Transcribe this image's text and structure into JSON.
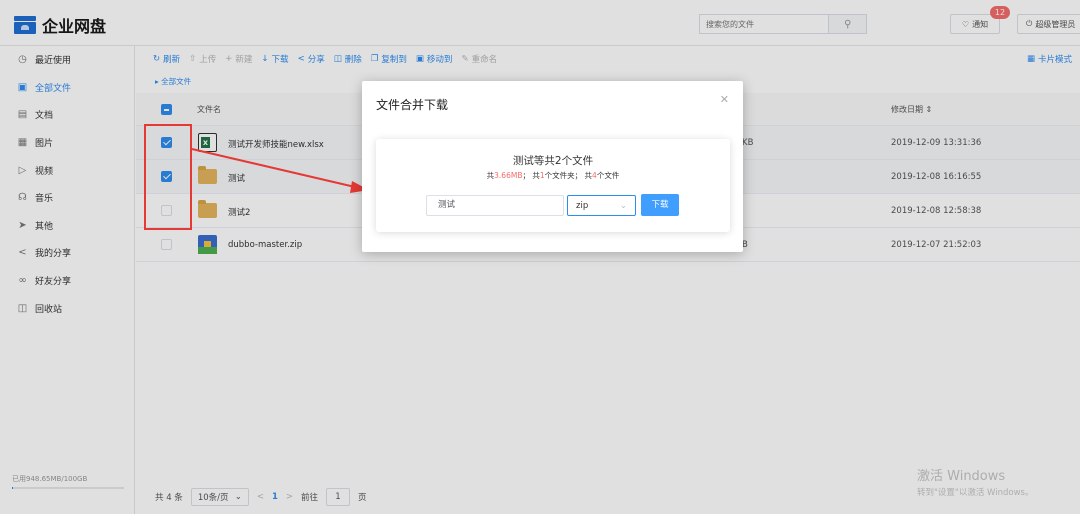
{
  "header": {
    "title": "企业网盘",
    "search_placeholder": "搜索您的文件",
    "notify_label": "通知",
    "notify_count": "12",
    "admin_label": "超级管理员"
  },
  "sidebar": {
    "items": [
      {
        "label": "最近使用",
        "icon": "clock-icon"
      },
      {
        "label": "全部文件",
        "icon": "folder-icon"
      },
      {
        "label": "文档",
        "icon": "document-icon"
      },
      {
        "label": "图片",
        "icon": "image-icon"
      },
      {
        "label": "视频",
        "icon": "video-icon"
      },
      {
        "label": "音乐",
        "icon": "headphones-icon"
      },
      {
        "label": "其他",
        "icon": "pin-icon"
      },
      {
        "label": "我的分享",
        "icon": "share-icon"
      },
      {
        "label": "好友分享",
        "icon": "link-icon"
      },
      {
        "label": "回收站",
        "icon": "trash-icon"
      }
    ],
    "active_index": 1,
    "storage_text": "已用948.65MB/100GB",
    "storage_fraction": 0.0093
  },
  "toolbar": {
    "refresh": "刷新",
    "upload": "上传",
    "new": "新建",
    "download": "下载",
    "share": "分享",
    "delete": "删除",
    "copy_to": "复制到",
    "move_to": "移动到",
    "rename": "重命名",
    "card_mode": "卡片模式"
  },
  "breadcrumb": {
    "root": "全部文件"
  },
  "table": {
    "headers": {
      "name": "文件名",
      "date": "修改日期"
    },
    "rows": [
      {
        "name": "测试开发师技能new.xlsx",
        "size": "KB",
        "date": "2019-12-09 13:31:36",
        "type": "xlsx",
        "checked": true
      },
      {
        "name": "测试",
        "size": "",
        "date": "2019-12-08 16:16:55",
        "type": "folder",
        "checked": true
      },
      {
        "name": "测试2",
        "size": "",
        "date": "2019-12-08 12:58:38",
        "type": "folder",
        "checked": false
      },
      {
        "name": "dubbo-master.zip",
        "size": "B",
        "date": "2019-12-07 21:52:03",
        "type": "zip",
        "checked": false
      }
    ]
  },
  "pagination": {
    "total": "共 4 条",
    "page_size": "10条/页",
    "current": "1",
    "goto_prefix": "前往",
    "goto_value": "1",
    "goto_suffix": "页"
  },
  "watermark": {
    "line1": "激活 Windows",
    "line2": "转到\"设置\"以激活 Windows。"
  },
  "modal": {
    "title": "文件合并下载",
    "heading": "测试等共2个文件",
    "summary_p1": "共",
    "summary_size": "3.66MB",
    "summary_p2": "； 共",
    "summary_folders": "1",
    "summary_p3": "个文件夹； 共",
    "summary_files": "4",
    "summary_p4": "个文件",
    "filename_value": "测试",
    "format_value": "zip",
    "download_button": "下载"
  },
  "colors": {
    "accent": "#2d8cf0",
    "highlight": "#e53935",
    "badge": "#f56c6c"
  }
}
